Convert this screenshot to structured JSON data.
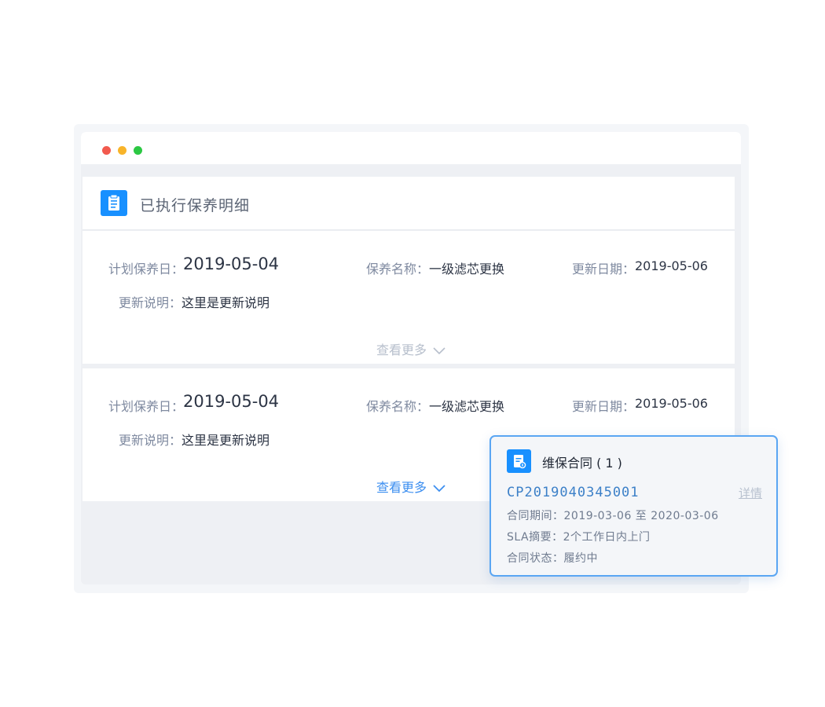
{
  "window": {
    "dots": [
      "close",
      "minimize",
      "maximize"
    ]
  },
  "panel": {
    "title": "已执行保养明细",
    "icon": "clipboard-icon",
    "accent_color": "#1890ff"
  },
  "records": [
    {
      "plan_date_label": "计划保养日：",
      "plan_date": "2019-05-04",
      "name_label": "保养名称：",
      "name": "一级滤芯更换",
      "update_date_label": "更新日期：",
      "update_date": "2019-05-06",
      "note_label": "更新说明：",
      "note": "这里是更新说明",
      "more_label": "查看更多"
    },
    {
      "plan_date_label": "计划保养日：",
      "plan_date": "2019-05-04",
      "name_label": "保养名称：",
      "name": "一级滤芯更换",
      "update_date_label": "更新日期：",
      "update_date": "2019-05-06",
      "note_label": "更新说明：",
      "note": "这里是更新说明",
      "more_label": "查看更多"
    }
  ],
  "contract_popup": {
    "title": "维保合同 ( 1 )",
    "icon": "contract-document-icon",
    "contract_no": "CP2019040345001",
    "detail_label": "详情",
    "period": "合同期间：2019-03-06 至 2020-03-06",
    "sla": "SLA摘要：2个工作日内上门",
    "status": "合同状态：履约中",
    "border_color": "#5aa6f3"
  }
}
